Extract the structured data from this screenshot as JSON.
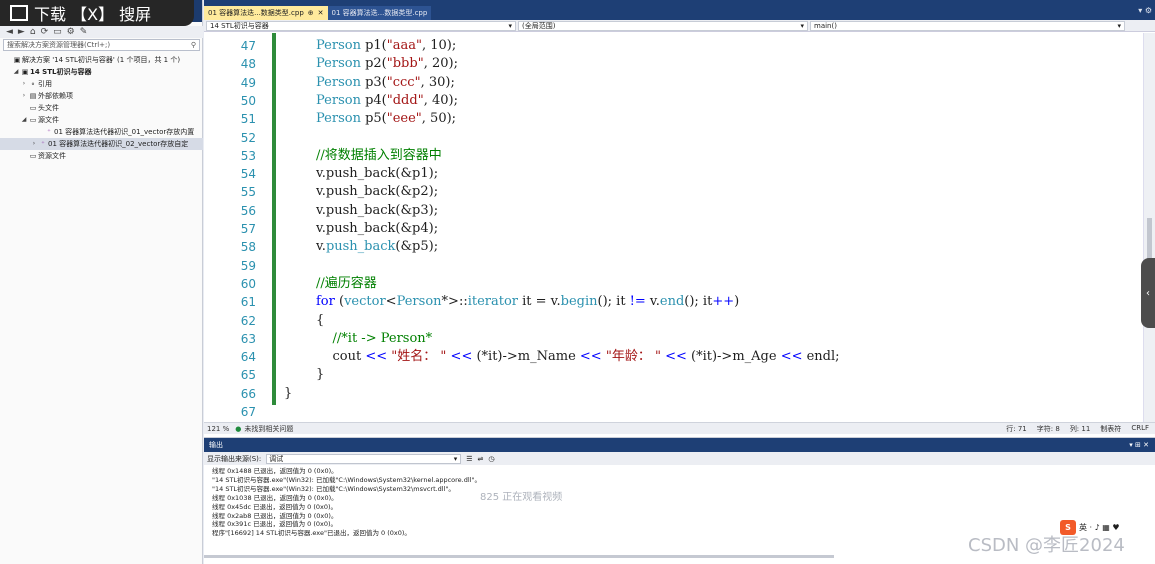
{
  "download_bar": {
    "label": "下载 【X】 搜屏"
  },
  "solution": {
    "header_title": "解决方案资源管理器",
    "search_placeholder": "搜索解决方案资源管理器(Ctrl+;)",
    "items": [
      {
        "label": "解决方案 '14 STL初识与容器' (1 个项目，共 1 个)",
        "icon": "solution-icon"
      },
      {
        "label": "14 STL初识与容器",
        "icon": "project-icon"
      },
      {
        "label": "引用",
        "icon": "references-icon"
      },
      {
        "label": "外部依赖项",
        "icon": "external-deps-icon"
      },
      {
        "label": "头文件",
        "icon": "folder-icon"
      },
      {
        "label": "源文件",
        "icon": "folder-icon"
      },
      {
        "label": "01 容器算法迭代器初识_01_vector存放内置",
        "icon": "cpp-file-icon"
      },
      {
        "label": "01 容器算法迭代器初识_02_vector存放自定",
        "icon": "cpp-file-icon"
      },
      {
        "label": "资源文件",
        "icon": "folder-icon"
      }
    ]
  },
  "tabs": [
    {
      "label": "01 容器算法迭...数据类型.cpp",
      "active": true
    },
    {
      "label": "01 容器算法迭...数据类型.cpp",
      "active": false
    }
  ],
  "nav": {
    "project": "14 STL初识与容器",
    "scope": "(全局范围)",
    "function": "main()"
  },
  "code": [
    {
      "n": "47",
      "tokens": [
        [
          "ty",
          "Person"
        ],
        [
          "id",
          " p1("
        ],
        [
          "st",
          "\"aaa\""
        ],
        [
          "id",
          ", 10);"
        ]
      ]
    },
    {
      "n": "48",
      "tokens": [
        [
          "ty",
          "Person"
        ],
        [
          "id",
          " p2("
        ],
        [
          "st",
          "\"bbb\""
        ],
        [
          "id",
          ", 20);"
        ]
      ]
    },
    {
      "n": "49",
      "tokens": [
        [
          "ty",
          "Person"
        ],
        [
          "id",
          " p3("
        ],
        [
          "st",
          "\"ccc\""
        ],
        [
          "id",
          ", 30);"
        ]
      ]
    },
    {
      "n": "50",
      "tokens": [
        [
          "ty",
          "Person"
        ],
        [
          "id",
          " p4("
        ],
        [
          "st",
          "\"ddd\""
        ],
        [
          "id",
          ", 40);"
        ]
      ]
    },
    {
      "n": "51",
      "tokens": [
        [
          "ty",
          "Person"
        ],
        [
          "id",
          " p5("
        ],
        [
          "st",
          "\"eee\""
        ],
        [
          "id",
          ", 50);"
        ]
      ]
    },
    {
      "n": "52",
      "tokens": []
    },
    {
      "n": "53",
      "tokens": [
        [
          "cm",
          "//将数据插入到容器中"
        ]
      ]
    },
    {
      "n": "54",
      "tokens": [
        [
          "id",
          "v.push_back(&p1);"
        ]
      ]
    },
    {
      "n": "55",
      "tokens": [
        [
          "id",
          "v.push_back(&p2);"
        ]
      ]
    },
    {
      "n": "56",
      "tokens": [
        [
          "id",
          "v.push_back(&p3);"
        ]
      ]
    },
    {
      "n": "57",
      "tokens": [
        [
          "id",
          "v.push_back(&p4);"
        ]
      ]
    },
    {
      "n": "58",
      "tokens": [
        [
          "id",
          "v."
        ],
        [
          "ty",
          "push_back"
        ],
        [
          "id",
          "(&p5);"
        ]
      ]
    },
    {
      "n": "59",
      "tokens": []
    },
    {
      "n": "60",
      "tokens": [
        [
          "cm",
          "//遍历容器"
        ]
      ]
    },
    {
      "n": "61",
      "tokens": [
        [
          "kw",
          "for"
        ],
        [
          "id",
          " ("
        ],
        [
          "ty",
          "vector"
        ],
        [
          "op",
          "<"
        ],
        [
          "ty",
          "Person"
        ],
        [
          "id",
          "*"
        ],
        [
          "op",
          ">"
        ],
        [
          "id",
          "::"
        ],
        [
          "ty",
          "iterator"
        ],
        [
          "id",
          " it = v."
        ],
        [
          "ty",
          "begin"
        ],
        [
          "id",
          "(); it "
        ],
        [
          "kw",
          "!="
        ],
        [
          "id",
          " v."
        ],
        [
          "ty",
          "end"
        ],
        [
          "id",
          "(); it"
        ],
        [
          "kw",
          "++"
        ],
        [
          "id",
          ")"
        ]
      ]
    },
    {
      "n": "62",
      "tokens": [
        [
          "id",
          "{"
        ]
      ]
    },
    {
      "n": "63",
      "tokens": [
        [
          "id",
          "    "
        ],
        [
          "cm",
          "//*it -> Person*"
        ]
      ]
    },
    {
      "n": "64",
      "tokens": [
        [
          "id",
          "    cout "
        ],
        [
          "kw",
          "<<"
        ],
        [
          "st",
          " \"姓名： \""
        ],
        [
          "id",
          " "
        ],
        [
          "kw",
          "<<"
        ],
        [
          "id",
          " (*it)->m_Name "
        ],
        [
          "kw",
          "<<"
        ],
        [
          "st",
          " \"年龄： \""
        ],
        [
          "id",
          " "
        ],
        [
          "kw",
          "<<"
        ],
        [
          "id",
          " (*it)->m_Age "
        ],
        [
          "kw",
          "<<"
        ],
        [
          "id",
          " endl;"
        ]
      ]
    },
    {
      "n": "65",
      "tokens": [
        [
          "id",
          "}"
        ]
      ]
    },
    {
      "n": "66",
      "tokens": [
        [
          "id",
          "}"
        ]
      ]
    },
    {
      "n": "67",
      "tokens": []
    }
  ],
  "status": {
    "zoom": "121 %",
    "issues": "未找到相关问题",
    "line": "行: 71",
    "char": "字符: 8",
    "col": "列: 11",
    "tabs": "制表符",
    "eol": "CRLF"
  },
  "output": {
    "title": "输出",
    "source_label": "显示输出来源(S):",
    "source_value": "调试",
    "lines": [
      "线程 0x1488 已退出，返回值为 0 (0x0)。",
      "\"14 STL初识与容器.exe\"(Win32): 已加载\"C:\\Windows\\System32\\kernel.appcore.dll\"。",
      "\"14 STL初识与容器.exe\"(Win32): 已加载\"C:\\Windows\\System32\\msvcrt.dll\"。",
      "线程 0x1038 已退出，返回值为 0 (0x0)。",
      "线程 0x45dc 已退出，返回值为 0 (0x0)。",
      "线程 0x2ab8 已退出，返回值为 0 (0x0)。",
      "线程 0x391c 已退出，返回值为 0 (0x0)。",
      "程序\"[16692] 14 STL初识与容器.exe\"已退出，返回值为 0 (0x0)。"
    ]
  },
  "watermark": "CSDN @李匠2024",
  "viewer_note": "825 正在观看视频"
}
